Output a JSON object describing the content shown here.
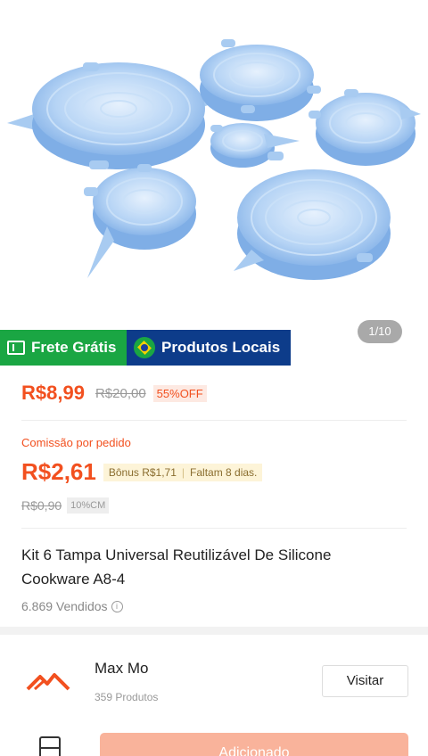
{
  "product": {
    "image_counter": "1/10",
    "badges": {
      "free_shipping": "Frete Grátis",
      "local_products": "Produtos Locais"
    },
    "price": "R$8,99",
    "old_price": "R$20,00",
    "discount": "55%OFF",
    "commission_label": "Comissão por pedido",
    "commission_value": "R$2,61",
    "bonus": "Bônus R$1,71",
    "days_left": "Faltam 8 dias.",
    "commission_old": "R$0,90",
    "commission_rate": "10%CM",
    "title": "Kit 6 Tampa Universal Reutilizável De Silicone Cookware A8-4",
    "sold": "6.869 Vendidos",
    "info_glyph": "i"
  },
  "store": {
    "name": "Max Mo",
    "products": "359 Produtos",
    "visit_label": "Visitar"
  },
  "bottom_bar": {
    "add_label": "Adicionado"
  },
  "colors": {
    "accent": "#f2501f",
    "free_shipping_bg": "#1aa643",
    "local_products_bg": "#0d3c8a",
    "lid_blue": "#7fb0e8"
  },
  "icons": [
    "truck-icon",
    "brazil-flag-icon",
    "info-icon",
    "store-logo-icon",
    "store-icon"
  ]
}
